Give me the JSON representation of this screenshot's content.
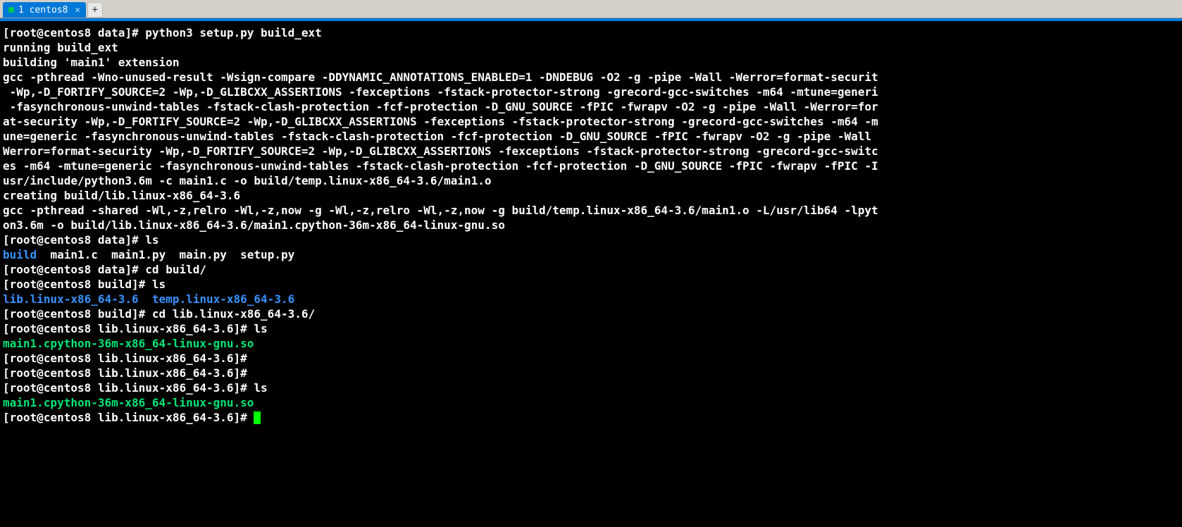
{
  "tab": {
    "label": "1 centos8",
    "close": "×"
  },
  "newTabLabel": "+",
  "lines": [
    {
      "segments": [
        {
          "t": "[root@centos8 data]# python3 setup.py build_ext"
        }
      ]
    },
    {
      "segments": [
        {
          "t": "running build_ext"
        }
      ]
    },
    {
      "segments": [
        {
          "t": "building 'main1' extension"
        }
      ]
    },
    {
      "segments": [
        {
          "t": "gcc -pthread -Wno-unused-result -Wsign-compare -DDYNAMIC_ANNOTATIONS_ENABLED=1 -DNDEBUG -O2 -g -pipe -Wall -Werror=format-securit"
        }
      ]
    },
    {
      "segments": [
        {
          "t": " -Wp,-D_FORTIFY_SOURCE=2 -Wp,-D_GLIBCXX_ASSERTIONS -fexceptions -fstack-protector-strong -grecord-gcc-switches -m64 -mtune=generi"
        }
      ]
    },
    {
      "segments": [
        {
          "t": " -fasynchronous-unwind-tables -fstack-clash-protection -fcf-protection -D_GNU_SOURCE -fPIC -fwrapv -O2 -g -pipe -Wall -Werror=for"
        }
      ]
    },
    {
      "segments": [
        {
          "t": "at-security -Wp,-D_FORTIFY_SOURCE=2 -Wp,-D_GLIBCXX_ASSERTIONS -fexceptions -fstack-protector-strong -grecord-gcc-switches -m64 -m"
        }
      ]
    },
    {
      "segments": [
        {
          "t": "une=generic -fasynchronous-unwind-tables -fstack-clash-protection -fcf-protection -D_GNU_SOURCE -fPIC -fwrapv -O2 -g -pipe -Wall "
        }
      ]
    },
    {
      "segments": [
        {
          "t": "Werror=format-security -Wp,-D_FORTIFY_SOURCE=2 -Wp,-D_GLIBCXX_ASSERTIONS -fexceptions -fstack-protector-strong -grecord-gcc-switc"
        }
      ]
    },
    {
      "segments": [
        {
          "t": "es -m64 -mtune=generic -fasynchronous-unwind-tables -fstack-clash-protection -fcf-protection -D_GNU_SOURCE -fPIC -fwrapv -fPIC -I"
        }
      ]
    },
    {
      "segments": [
        {
          "t": "usr/include/python3.6m -c main1.c -o build/temp.linux-x86_64-3.6/main1.o"
        }
      ]
    },
    {
      "segments": [
        {
          "t": "creating build/lib.linux-x86_64-3.6"
        }
      ]
    },
    {
      "segments": [
        {
          "t": "gcc -pthread -shared -Wl,-z,relro -Wl,-z,now -g -Wl,-z,relro -Wl,-z,now -g build/temp.linux-x86_64-3.6/main1.o -L/usr/lib64 -lpyt"
        }
      ]
    },
    {
      "segments": [
        {
          "t": "on3.6m -o build/lib.linux-x86_64-3.6/main1.cpython-36m-x86_64-linux-gnu.so"
        }
      ]
    },
    {
      "segments": [
        {
          "t": "[root@centos8 data]# ls"
        }
      ]
    },
    {
      "segments": [
        {
          "t": "build",
          "c": "c-blue"
        },
        {
          "t": "  main1.c  main1.py  main.py  setup.py"
        }
      ]
    },
    {
      "segments": [
        {
          "t": "[root@centos8 data]# cd build/"
        }
      ]
    },
    {
      "segments": [
        {
          "t": "[root@centos8 build]# ls"
        }
      ]
    },
    {
      "segments": [
        {
          "t": "lib.linux-x86_64-3.6",
          "c": "c-blue"
        },
        {
          "t": "  "
        },
        {
          "t": "temp.linux-x86_64-3.6",
          "c": "c-blue"
        }
      ]
    },
    {
      "segments": [
        {
          "t": "[root@centos8 build]# cd lib.linux-x86_64-3.6/"
        }
      ]
    },
    {
      "segments": [
        {
          "t": "[root@centos8 lib.linux-x86_64-3.6]# ls"
        }
      ]
    },
    {
      "segments": [
        {
          "t": "main1.cpython-36m-x86_64-linux-gnu.so",
          "c": "c-green"
        }
      ]
    },
    {
      "segments": [
        {
          "t": "[root@centos8 lib.linux-x86_64-3.6]# "
        }
      ]
    },
    {
      "segments": [
        {
          "t": "[root@centos8 lib.linux-x86_64-3.6]# "
        }
      ]
    },
    {
      "segments": [
        {
          "t": "[root@centos8 lib.linux-x86_64-3.6]# ls"
        }
      ]
    },
    {
      "segments": [
        {
          "t": "main1.cpython-36m-x86_64-linux-gnu.so",
          "c": "c-green"
        }
      ]
    },
    {
      "segments": [
        {
          "t": "[root@centos8 lib.linux-x86_64-3.6]# "
        }
      ],
      "cursor": true
    }
  ]
}
